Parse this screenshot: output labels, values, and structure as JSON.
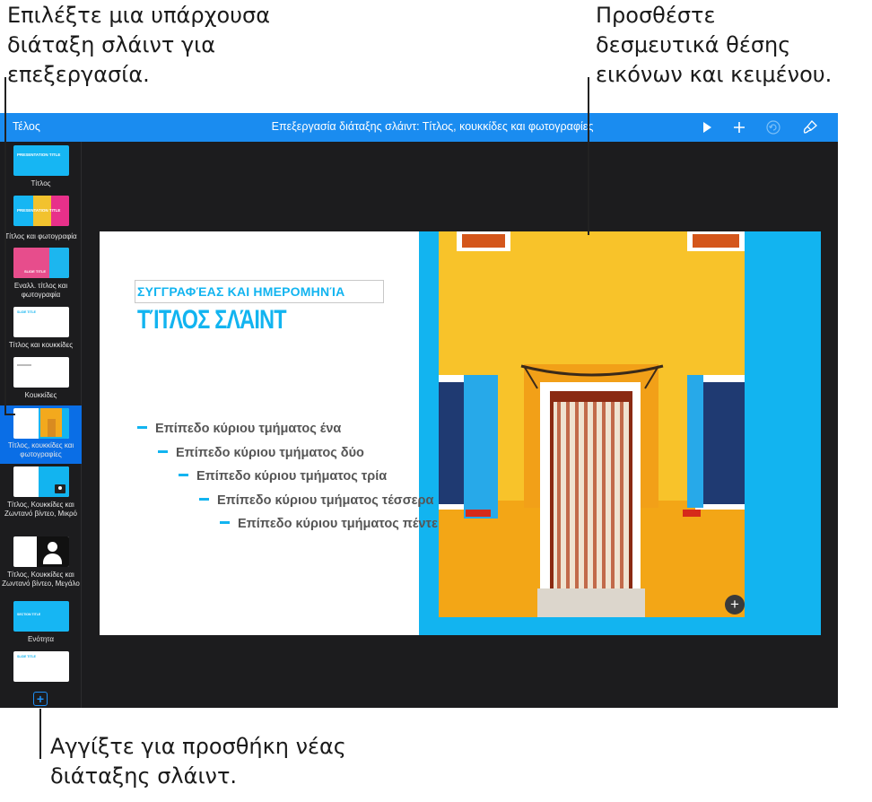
{
  "callouts": {
    "top_left": [
      "Επιλέξτε μια υπάρχουσα",
      "διάταξη σλάιντ για",
      "επεξεργασία."
    ],
    "top_right": [
      "Προσθέστε",
      "δεσμευτικά θέσης",
      "εικόνων και κειμένου."
    ],
    "bottom": [
      "Αγγίξτε για προσθήκη νέας",
      "διάταξης σλάιντ."
    ]
  },
  "toolbar": {
    "done_label": "Τέλος",
    "title_prefix": "Επεξεργασία διάταξης σλάιντ:",
    "title_layout": "Τίτλος, κουκκίδες και φωτογραφίες",
    "icons": [
      "play-icon",
      "plus-icon",
      "undo-icon",
      "paintbrush-icon"
    ]
  },
  "sidebar": {
    "layouts": [
      {
        "label": "Τίτλος",
        "thumb_text": "PRESENTATION TITLE"
      },
      {
        "label": "Τίτλος και φωτογραφία",
        "thumb_text": "PRESENTATION TITLE"
      },
      {
        "label": "Εναλλ. τίτλος και φωτογραφία",
        "thumb_text": "SLIDE TITLE"
      },
      {
        "label": "Τίτλος και κουκκίδες",
        "thumb_text": "SLIDE TITLE"
      },
      {
        "label": "Κουκκίδες"
      },
      {
        "label": "Τίτλος, κουκκίδες και φωτογραφίες",
        "selected": true
      },
      {
        "label": "Τίτλος, Κουκκίδες και Ζωντανό βίντεο, Μικρό"
      },
      {
        "label": "Τίτλος, Κουκκίδες και Ζωντανό βίντεο, Μεγάλο"
      },
      {
        "label": "Ενότητα",
        "thumb_text": "SECTION TITLE"
      },
      {
        "label": "",
        "thumb_text": "SLIDE TITLE"
      }
    ],
    "add_icon": "plus-square-icon"
  },
  "slide": {
    "author": "ΣΥΓΓΡΑΦΈΑΣ ΚΑΙ ΗΜΕΡΟΜΗΝΊΑ",
    "title": "ΤΊΤΛΟΣ ΣΛΆΙΝΤ",
    "bullets": [
      "Επίπεδο κύριου τμήματος ένα",
      "Επίπεδο κύριου τμήματος δύο",
      "Επίπεδο κύριου τμήματος τρία",
      "Επίπεδο κύριου τμήματος τέσσερα",
      "Επίπεδο κύριου τμήματος πέντε"
    ],
    "accent_color": "#12b4f0",
    "photo_add_icon": "plus-icon"
  }
}
